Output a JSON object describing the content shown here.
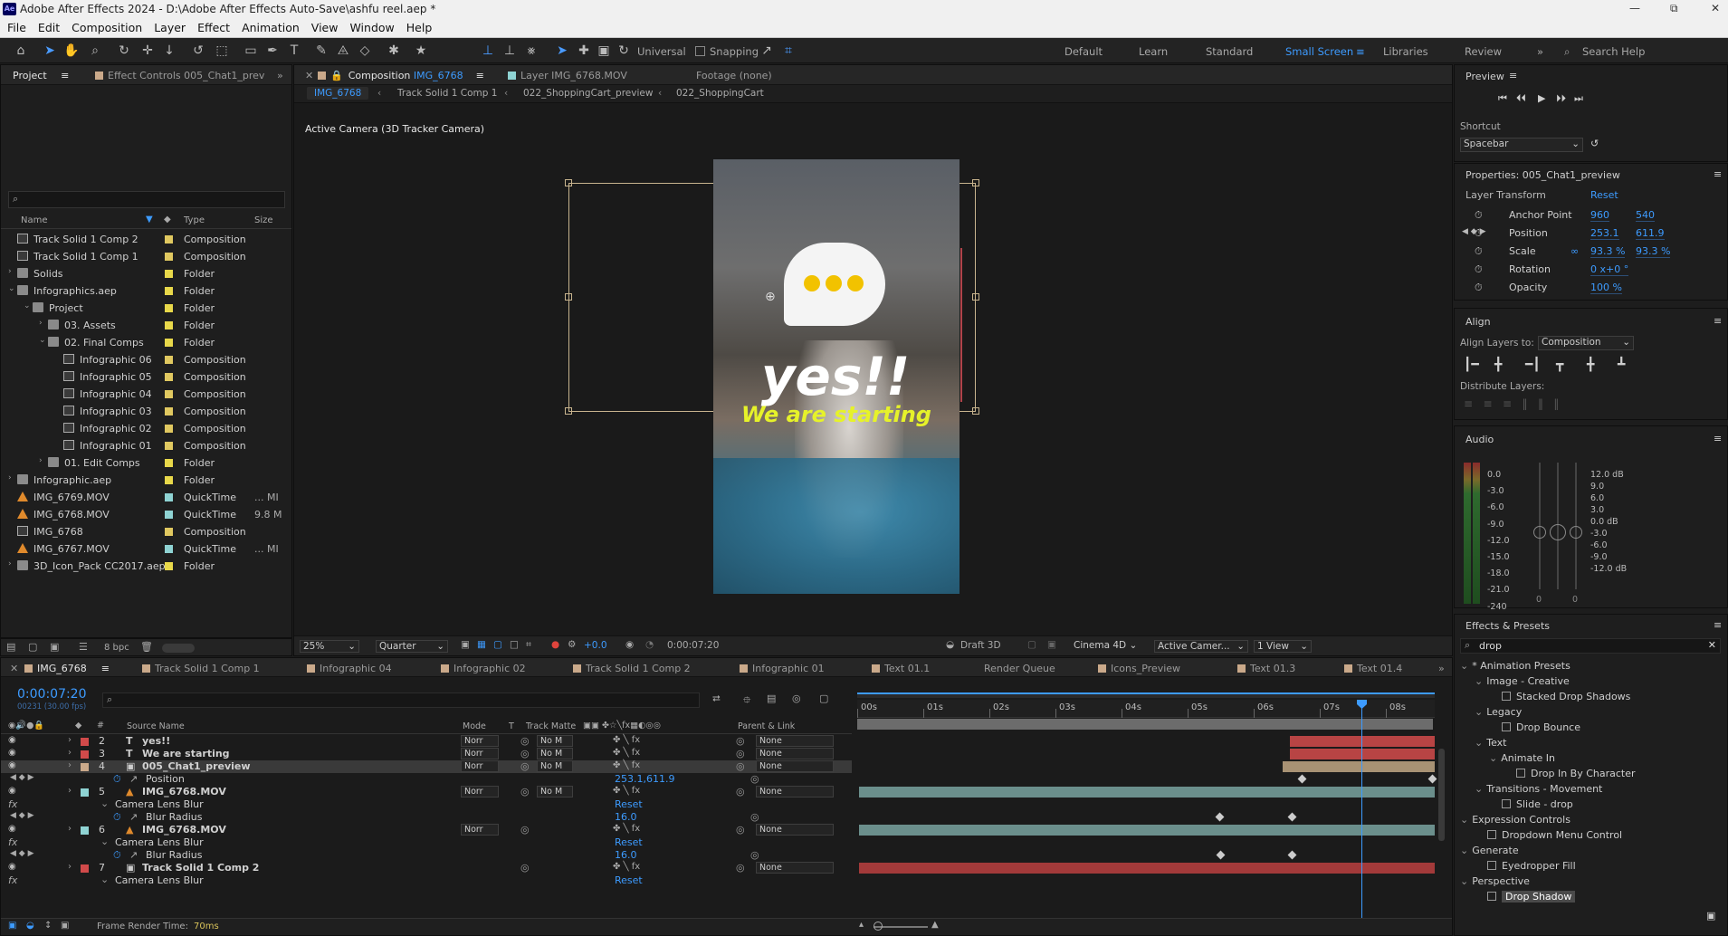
{
  "app": {
    "title": "Adobe After Effects 2024 - D:\\Adobe After Effects Auto-Save\\ashfu reel.aep *"
  },
  "menu": [
    "File",
    "Edit",
    "Composition",
    "Layer",
    "Effect",
    "Animation",
    "View",
    "Window",
    "Help"
  ],
  "toolbar": {
    "universal_label": "Universal",
    "snapping_label": "Snapping",
    "workspaces": [
      "Default",
      "Learn",
      "Standard",
      "Small Screen",
      "Libraries",
      "Review"
    ],
    "active_workspace": "Small Screen",
    "search_help": "Search Help"
  },
  "project": {
    "tab_label": "Project",
    "effect_controls_tab": "Effect Controls 005_Chat1_prev",
    "columns": {
      "name": "Name",
      "type": "Type",
      "size": "Size"
    },
    "items": [
      {
        "name": "Track Solid 1 Comp 2",
        "type": "Composition",
        "size": "",
        "indent": 0,
        "icon": "comp",
        "color": "#e0c860",
        "arrow": ""
      },
      {
        "name": "Track Solid 1 Comp 1",
        "type": "Composition",
        "size": "",
        "indent": 0,
        "icon": "comp",
        "color": "#e0c860",
        "arrow": ""
      },
      {
        "name": "Solids",
        "type": "Folder",
        "size": "",
        "indent": 0,
        "icon": "folder",
        "color": "#e8d84a",
        "arrow": "right"
      },
      {
        "name": "Infographics.aep",
        "type": "Folder",
        "size": "",
        "indent": 0,
        "icon": "folder",
        "color": "#e8d84a",
        "arrow": "down"
      },
      {
        "name": "Project",
        "type": "Folder",
        "size": "",
        "indent": 1,
        "icon": "folder",
        "color": "#e8d84a",
        "arrow": "down"
      },
      {
        "name": "03. Assets",
        "type": "Folder",
        "size": "",
        "indent": 2,
        "icon": "folder",
        "color": "#e8d84a",
        "arrow": "right"
      },
      {
        "name": "02. Final Comps",
        "type": "Folder",
        "size": "",
        "indent": 2,
        "icon": "folder",
        "color": "#e8d84a",
        "arrow": "down"
      },
      {
        "name": "Infographic 06",
        "type": "Composition",
        "size": "",
        "indent": 3,
        "icon": "comp",
        "color": "#e0c860",
        "arrow": ""
      },
      {
        "name": "Infographic 05",
        "type": "Composition",
        "size": "",
        "indent": 3,
        "icon": "comp",
        "color": "#e0c860",
        "arrow": ""
      },
      {
        "name": "Infographic 04",
        "type": "Composition",
        "size": "",
        "indent": 3,
        "icon": "comp",
        "color": "#e0c860",
        "arrow": ""
      },
      {
        "name": "Infographic 03",
        "type": "Composition",
        "size": "",
        "indent": 3,
        "icon": "comp",
        "color": "#e0c860",
        "arrow": ""
      },
      {
        "name": "Infographic 02",
        "type": "Composition",
        "size": "",
        "indent": 3,
        "icon": "comp",
        "color": "#e0c860",
        "arrow": ""
      },
      {
        "name": "Infographic 01",
        "type": "Composition",
        "size": "",
        "indent": 3,
        "icon": "comp",
        "color": "#e0c860",
        "arrow": ""
      },
      {
        "name": "01. Edit Comps",
        "type": "Folder",
        "size": "",
        "indent": 2,
        "icon": "folder",
        "color": "#e8d84a",
        "arrow": "right"
      },
      {
        "name": "Infographic.aep",
        "type": "Folder",
        "size": "",
        "indent": 0,
        "icon": "folder",
        "color": "#e8d84a",
        "arrow": "right"
      },
      {
        "name": "IMG_6769.MOV",
        "type": "QuickTime",
        "size": "... MI",
        "indent": 0,
        "icon": "cone",
        "color": "#8fd3d3",
        "arrow": ""
      },
      {
        "name": "IMG_6768.MOV",
        "type": "QuickTime",
        "size": "9.8 M",
        "indent": 0,
        "icon": "cone",
        "color": "#8fd3d3",
        "arrow": ""
      },
      {
        "name": "IMG_6768",
        "type": "Composition",
        "size": "",
        "indent": 0,
        "icon": "comp",
        "color": "#e0c860",
        "arrow": ""
      },
      {
        "name": "IMG_6767.MOV",
        "type": "QuickTime",
        "size": "... MI",
        "indent": 0,
        "icon": "cone",
        "color": "#8fd3d3",
        "arrow": ""
      },
      {
        "name": "3D_Icon_Pack CC2017.aep",
        "type": "Folder",
        "size": "",
        "indent": 0,
        "icon": "folder",
        "color": "#e8d84a",
        "arrow": "right"
      }
    ],
    "bpc": "8 bpc"
  },
  "composition": {
    "tab_label": "Composition",
    "tab_comp_name": "IMG_6768",
    "layer_tab": "Layer IMG_6768.MOV",
    "footage_tab": "Footage (none)",
    "breadcrumbs": [
      "IMG_6768",
      "Track Solid 1 Comp 1",
      "022_ShoppingCart_preview",
      "022_ShoppingCart"
    ],
    "camera_label": "Active Camera (3D Tracker Camera)",
    "overlay_text_1": "yes!!",
    "overlay_text_2": "We are starting",
    "zoom": "25%",
    "resolution": "Quarter",
    "exposure": "+0.0",
    "timecode": "0:00:07:20",
    "draft3d": "Draft 3D",
    "renderer": "Cinema 4D",
    "camera_select": "Active Camer...",
    "view_count": "1 View"
  },
  "preview": {
    "title": "Preview",
    "shortcut_label": "Shortcut",
    "shortcut_value": "Spacebar"
  },
  "properties": {
    "title": "Properties: 005_Chat1_preview",
    "section": "Layer Transform",
    "reset": "Reset",
    "rows": [
      {
        "label": "Anchor Point",
        "v1": "960",
        "v2": "540"
      },
      {
        "label": "Position",
        "v1": "253.1",
        "v2": "611.9"
      },
      {
        "label": "Scale",
        "v1": "93.3 %",
        "v2": "93.3 %"
      },
      {
        "label": "Rotation",
        "v1": "0 x+0 °",
        "v2": ""
      },
      {
        "label": "Opacity",
        "v1": "100 %",
        "v2": ""
      }
    ]
  },
  "align": {
    "title": "Align",
    "align_to_label": "Align Layers to:",
    "align_to_value": "Composition",
    "distribute_label": "Distribute Layers:"
  },
  "audio": {
    "title": "Audio",
    "left_scale": [
      "0.0",
      "-3.0",
      "-6.0",
      "-9.0",
      "-12.0",
      "-15.0",
      "-18.0",
      "-21.0",
      "-240"
    ],
    "right_scale": [
      "12.0 dB",
      "9.0",
      "6.0",
      "3.0",
      "0.0 dB",
      "-3.0",
      "-6.0",
      "-9.0",
      "-12.0 dB"
    ],
    "zeros": [
      "0",
      "0"
    ]
  },
  "effects": {
    "title": "Effects & Presets",
    "search": "drop",
    "tree": [
      {
        "label": "* Animation Presets",
        "level": 0,
        "kind": "folder"
      },
      {
        "label": "Image - Creative",
        "level": 1,
        "kind": "folder"
      },
      {
        "label": "Stacked Drop Shadows",
        "level": 2,
        "kind": "item"
      },
      {
        "label": "Legacy",
        "level": 1,
        "kind": "folder"
      },
      {
        "label": "Drop Bounce",
        "level": 2,
        "kind": "item"
      },
      {
        "label": "Text",
        "level": 1,
        "kind": "folder"
      },
      {
        "label": "Animate In",
        "level": 2,
        "kind": "folder"
      },
      {
        "label": "Drop In By Character",
        "level": 3,
        "kind": "item"
      },
      {
        "label": "Transitions - Movement",
        "level": 1,
        "kind": "folder"
      },
      {
        "label": "Slide - drop",
        "level": 2,
        "kind": "item"
      },
      {
        "label": "Expression Controls",
        "level": 0,
        "kind": "folder"
      },
      {
        "label": "Dropdown Menu Control",
        "level": 1,
        "kind": "item"
      },
      {
        "label": "Generate",
        "level": 0,
        "kind": "folder"
      },
      {
        "label": "Eyedropper Fill",
        "level": 1,
        "kind": "item"
      },
      {
        "label": "Perspective",
        "level": 0,
        "kind": "folder"
      },
      {
        "label": "Drop Shadow",
        "level": 1,
        "kind": "item",
        "selected": true
      }
    ]
  },
  "timeline": {
    "tabs": [
      "IMG_6768",
      "Track Solid 1 Comp 1",
      "Infographic 04",
      "Infographic 02",
      "Track Solid 1 Comp 2",
      "Infographic 01",
      "Text 01.1",
      "Render Queue",
      "Icons_Preview",
      "Text 01.3",
      "Text 01.4"
    ],
    "timecode": "0:00:07:20",
    "frame_info": "00231 (30.00 fps)",
    "columns": {
      "source": "Source Name",
      "mode": "Mode",
      "t": "T",
      "trackmatte": "Track Matte",
      "parent": "Parent & Link"
    },
    "ruler": [
      "00s",
      "01s",
      "02s",
      "03s",
      "04s",
      "05s",
      "06s",
      "07s",
      "08s"
    ],
    "rows": [
      {
        "kind": "layer",
        "num": "2",
        "name": "yes!!",
        "icon": "T",
        "color": "#d14a4a",
        "mode": "Norr",
        "matte": "No M",
        "parent": "None"
      },
      {
        "kind": "layer",
        "num": "3",
        "name": "We are starting",
        "icon": "T",
        "color": "#d14a4a",
        "mode": "Norr",
        "matte": "No M",
        "parent": "None"
      },
      {
        "kind": "layer",
        "num": "4",
        "name": "005_Chat1_preview",
        "icon": "comp",
        "color": "#caa98a",
        "mode": "Norr",
        "matte": "No M",
        "parent": "None",
        "selected": true
      },
      {
        "kind": "prop",
        "name": "Position",
        "value": "253.1,611.9"
      },
      {
        "kind": "layer",
        "num": "5",
        "name": "IMG_6768.MOV",
        "icon": "cone",
        "color": "#8fd3d3",
        "mode": "Norr",
        "matte": "No M",
        "parent": "None"
      },
      {
        "kind": "effect",
        "name": "Camera Lens Blur",
        "value": "Reset"
      },
      {
        "kind": "prop",
        "name": "Blur Radius",
        "value": "16.0"
      },
      {
        "kind": "layer",
        "num": "6",
        "name": "IMG_6768.MOV",
        "icon": "cone",
        "color": "#8fd3d3",
        "mode": "Norr",
        "matte": "",
        "parent": "None"
      },
      {
        "kind": "effect",
        "name": "Camera Lens Blur",
        "value": "Reset"
      },
      {
        "kind": "prop",
        "name": "Blur Radius",
        "value": "16.0"
      },
      {
        "kind": "layer",
        "num": "7",
        "name": "Track Solid 1 Comp 2",
        "icon": "comp",
        "color": "#d14a4a",
        "mode": "",
        "matte": "",
        "parent": "None"
      },
      {
        "kind": "effect",
        "name": "Camera Lens Blur",
        "value": "Reset"
      }
    ],
    "frame_render_label": "Frame Render Time:",
    "frame_render_value": "70ms"
  }
}
